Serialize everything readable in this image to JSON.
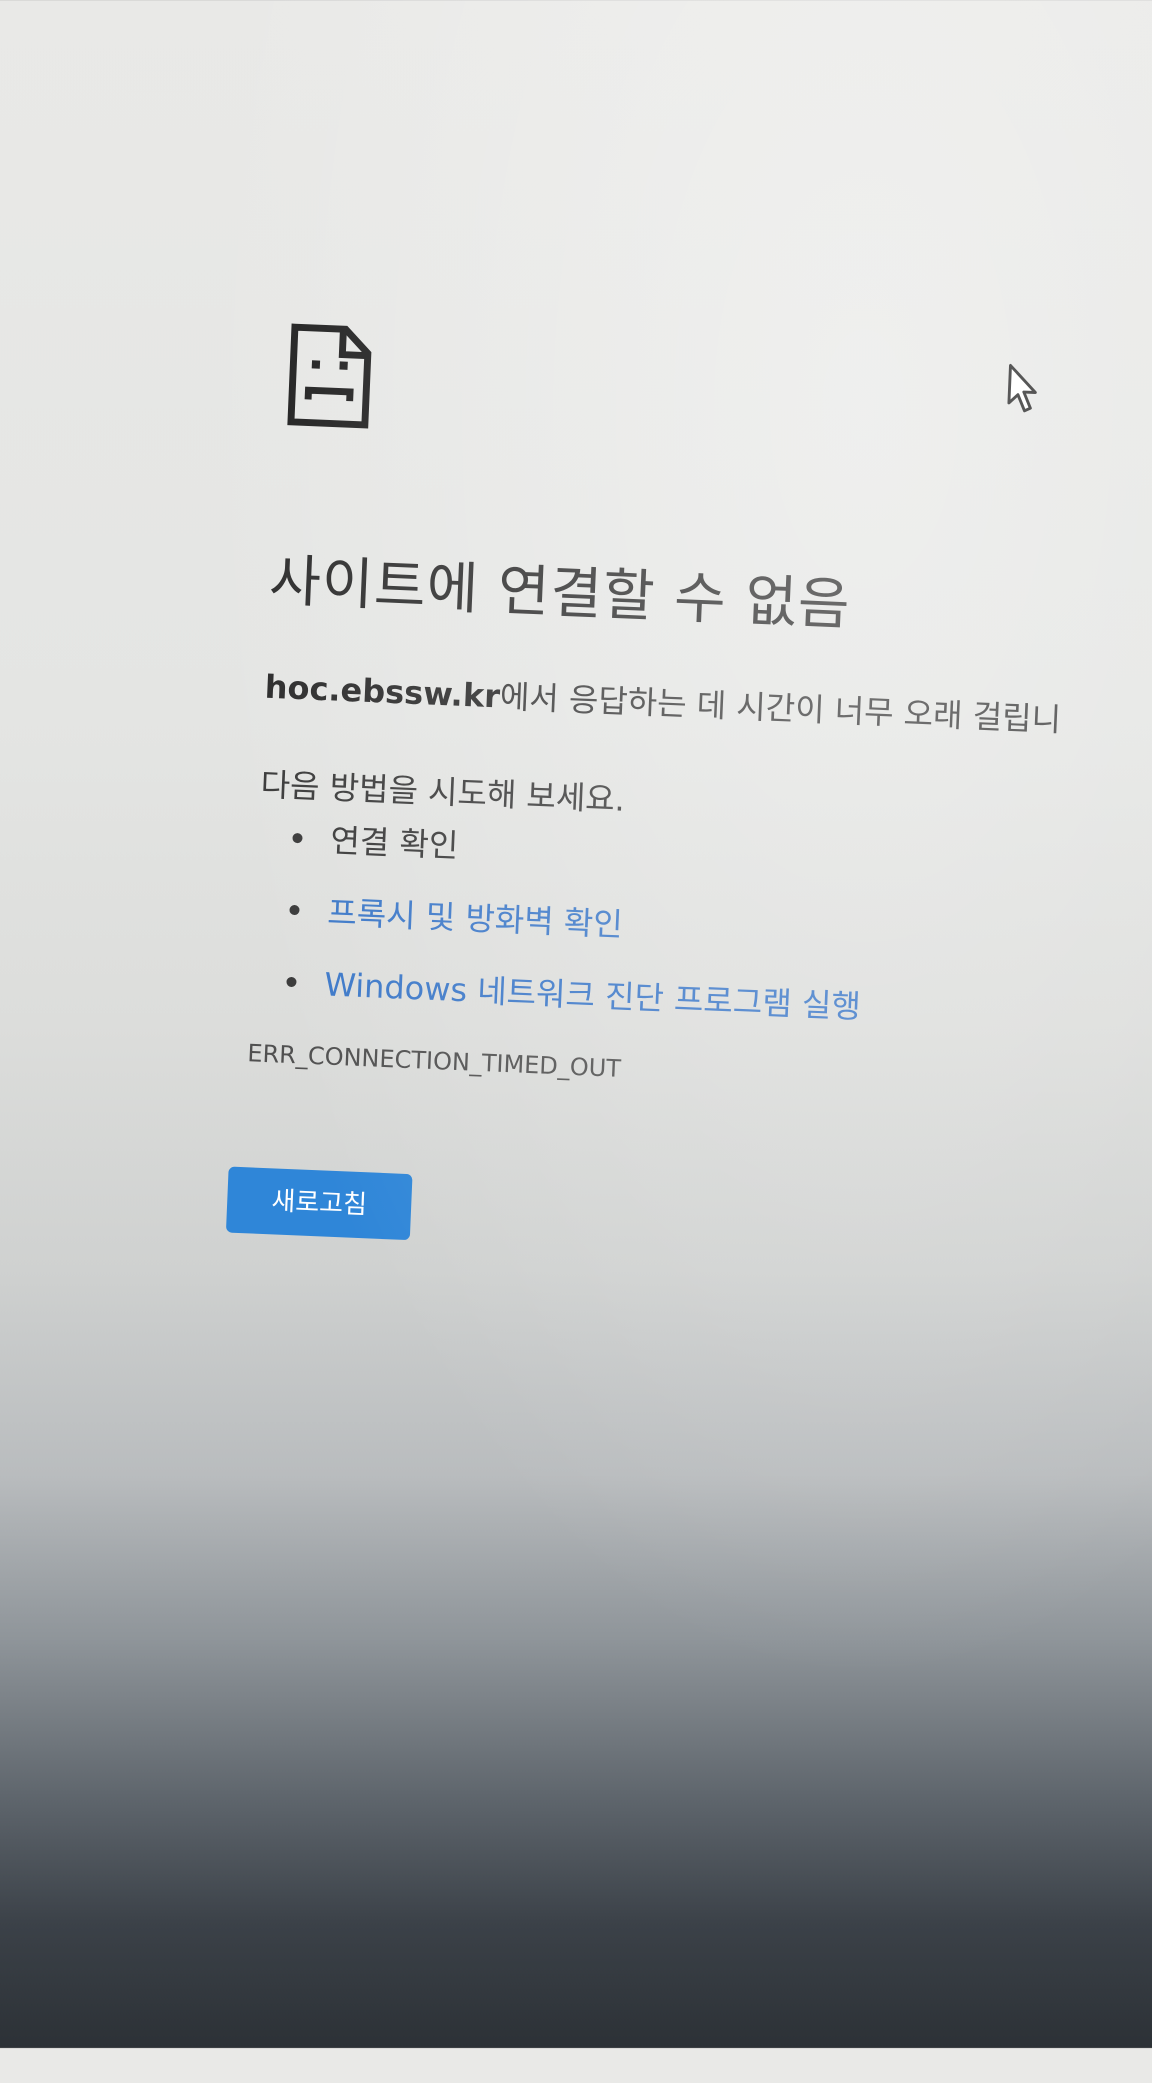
{
  "error_page": {
    "icon": "sad-page-icon",
    "title": "사이트에 연결할 수 없음",
    "host": "hoc.ebssw.kr",
    "message_suffix": "에서 응답하는 데 시간이 너무 오래 걸립니",
    "try_label": "다음 방법을 시도해 보세요.",
    "suggestions": [
      {
        "text": "연결 확인",
        "is_link": false
      },
      {
        "text": "프록시 및 방화벽 확인",
        "is_link": true
      },
      {
        "text": "Windows 네트워크 진단 프로그램 실행",
        "is_link": true
      }
    ],
    "error_code": "ERR_CONNECTION_TIMED_OUT",
    "reload_label": "새로고침"
  },
  "colors": {
    "link": "#3c78c8",
    "button": "#2f86d8",
    "text": "#3a3a3a"
  },
  "cursor": "mouse-pointer-icon"
}
